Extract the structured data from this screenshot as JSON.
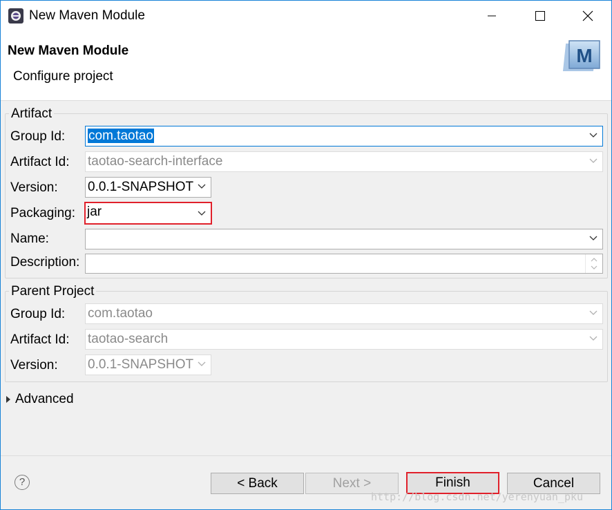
{
  "window": {
    "title": "New Maven Module",
    "controls": {
      "minimize": "—",
      "maximize": "☐",
      "close": "✕"
    }
  },
  "header": {
    "title": "New Maven Module",
    "subtitle": "Configure project",
    "icon_letter": "M"
  },
  "artifact": {
    "section_title": "Artifact",
    "group_id_label": "Group Id:",
    "group_id_value": "com.taotao",
    "artifact_id_label": "Artifact Id:",
    "artifact_id_value": "taotao-search-interface",
    "version_label": "Version:",
    "version_value": "0.0.1-SNAPSHOT",
    "packaging_label": "Packaging:",
    "packaging_value": "jar",
    "name_label": "Name:",
    "name_value": "",
    "description_label": "Description:",
    "description_value": ""
  },
  "parent": {
    "section_title": "Parent Project",
    "group_id_label": "Group Id:",
    "group_id_value": "com.taotao",
    "artifact_id_label": "Artifact Id:",
    "artifact_id_value": "taotao-search",
    "version_label": "Version:",
    "version_value": "0.0.1-SNAPSHOT"
  },
  "advanced": {
    "label": "Advanced"
  },
  "buttons": {
    "help": "?",
    "back": "< Back",
    "next": "Next >",
    "finish": "Finish",
    "cancel": "Cancel"
  },
  "watermark": "http://blog.csdn.net/yerenyuan_pku",
  "colors": {
    "accent": "#0078d7",
    "highlight_border": "#e0202a"
  }
}
